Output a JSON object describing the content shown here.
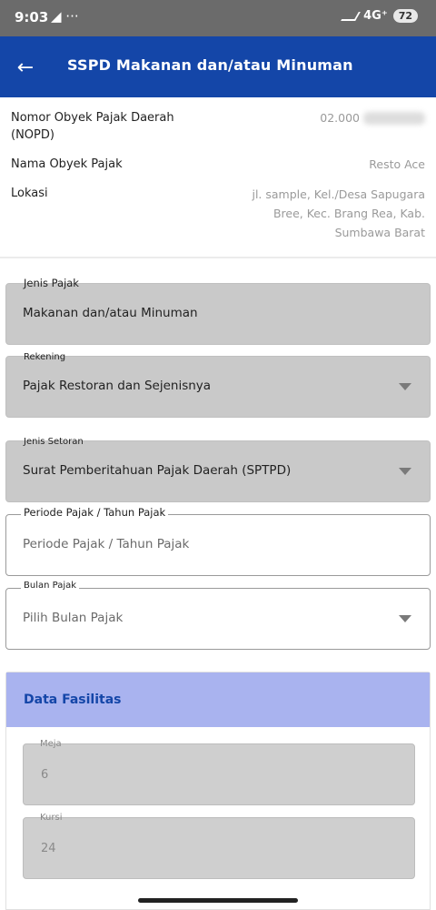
{
  "status_bar": {
    "time": "9:03",
    "left_icons": "◢ ···",
    "network": "4G⁺",
    "battery": "72"
  },
  "header": {
    "title": "SSPD Makanan dan/atau Minuman",
    "back_glyph": "←"
  },
  "info": {
    "nopd_label": "Nomor Obyek Pajak Daerah (NOPD)",
    "nopd_value": "02.000",
    "nama_label": "Nama Obyek Pajak",
    "nama_value": "Resto Ace",
    "lokasi_label": "Lokasi",
    "lokasi_value": "jl. sample, Kel./Desa Sapugara Bree, Kec. Brang Rea, Kab. Sumbawa Barat"
  },
  "form": {
    "jenis_pajak": {
      "label": "Jenis Pajak",
      "value": "Makanan dan/atau Minuman"
    },
    "rekening": {
      "label": "Rekening",
      "value": "Pajak Restoran dan Sejenisnya"
    },
    "jenis_setoran": {
      "label": "Jenis Setoran",
      "value": "Surat Pemberitahuan Pajak Daerah (SPTPD)"
    },
    "periode": {
      "label": "Periode Pajak / Tahun Pajak",
      "placeholder": "Periode Pajak / Tahun Pajak"
    },
    "bulan": {
      "label": "Bulan Pajak",
      "placeholder": "Pilih Bulan Pajak"
    }
  },
  "fasilitas": {
    "title": "Data Fasilitas",
    "meja": {
      "label": "Meja",
      "value": "6"
    },
    "kursi": {
      "label": "Kursi",
      "value": "24"
    }
  },
  "colors": {
    "app_bar": "#1446a8",
    "card_header": "#a9b3ef",
    "status_bar": "#6b6b6b"
  }
}
